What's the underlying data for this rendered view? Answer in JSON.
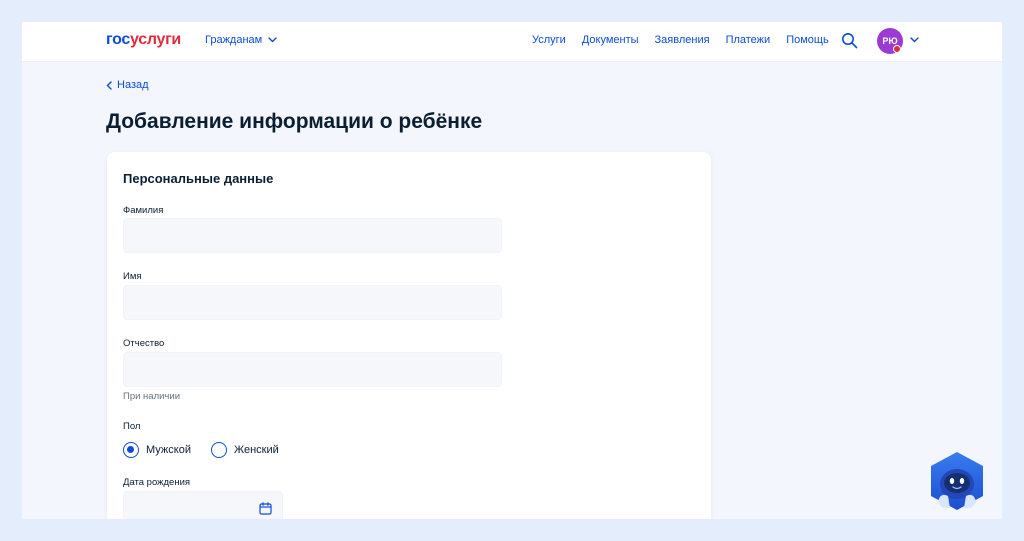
{
  "header": {
    "logo": {
      "part1": "гос",
      "part2": "услуги"
    },
    "audience": "Гражданам",
    "nav": [
      "Услуги",
      "Документы",
      "Заявления",
      "Платежи",
      "Помощь"
    ],
    "user_initials": "РЮ",
    "icons": {
      "search": "search-icon",
      "chevron": "chevron-down-icon"
    }
  },
  "back_label": "Назад",
  "page_title": "Добавление информации о ребёнке",
  "form": {
    "section_title": "Персональные данные",
    "surname_label": "Фамилия",
    "surname_value": "",
    "name_label": "Имя",
    "name_value": "",
    "patronymic_label": "Отчество",
    "patronymic_value": "",
    "patronymic_hint": "При наличии",
    "gender_label": "Пол",
    "gender_options": [
      "Мужской",
      "Женский"
    ],
    "gender_selected": "Мужской",
    "birthdate_label": "Дата рождения",
    "birthdate_value": ""
  },
  "colors": {
    "brand_blue": "#0d4cd3",
    "brand_red": "#e12c3d",
    "avatar": "#9c3bd3",
    "page_bg": "#f3f6fd",
    "input_bg": "#f5f7fa"
  },
  "assistant": {
    "icon": "robot-assistant-icon"
  }
}
